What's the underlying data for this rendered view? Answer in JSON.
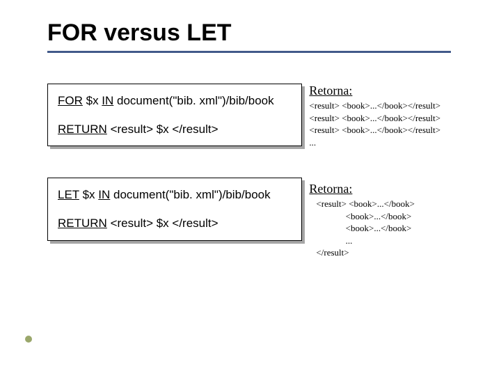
{
  "title": "FOR versus LET",
  "block1": {
    "line1_kw1": "FOR",
    "line1_var": " $x ",
    "line1_kw2": "IN",
    "line1_rest": " document(\"bib. xml\")/bib/book",
    "line2_kw": "RETURN",
    "line2_rest": " <result> $x </result>"
  },
  "result1": {
    "label": "Retorna:",
    "code": "<result> <book>...</book></result>\n<result> <book>...</book></result>\n<result> <book>...</book></result>\n..."
  },
  "block2": {
    "line1_kw1": "LET",
    "line1_var": " $x ",
    "line1_kw2": "IN",
    "line1_rest": " document(\"bib. xml\")/bib/book",
    "line2_kw": "RETURN",
    "line2_rest": " <result> $x </result>"
  },
  "result2": {
    "label": "Retorna:",
    "code": "<result> <book>...</book>\n             <book>...</book>\n             <book>...</book>\n             ...\n</result>"
  }
}
